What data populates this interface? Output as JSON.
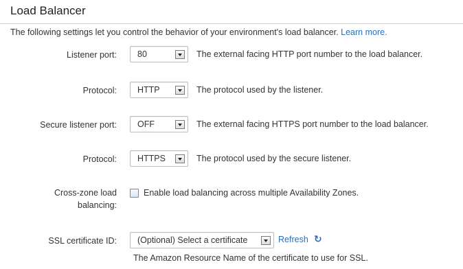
{
  "section": {
    "title": "Load Balancer",
    "intro_text": "The following settings let you control the behavior of your environment's load balancer.",
    "learn_more": "Learn more."
  },
  "fields": {
    "listener_port": {
      "label": "Listener port:",
      "value": "80",
      "help": "The external facing HTTP port number to the load balancer."
    },
    "protocol": {
      "label": "Protocol:",
      "value": "HTTP",
      "help": "The protocol used by the listener."
    },
    "secure_listener_port": {
      "label": "Secure listener port:",
      "value": "OFF",
      "help": "The external facing HTTPS port number to the load balancer."
    },
    "secure_protocol": {
      "label": "Protocol:",
      "value": "HTTPS",
      "help": "The protocol used by the secure listener."
    },
    "cross_zone": {
      "label_line1": "Cross-zone load",
      "label_line2": "balancing:",
      "checked": false,
      "checkbox_label": "Enable load balancing across multiple Availability Zones."
    },
    "ssl_certificate": {
      "label": "SSL certificate ID:",
      "value": "(Optional) Select a certificate",
      "refresh_label": "Refresh",
      "refresh_icon": "refresh-icon",
      "help": "The Amazon Resource Name of the certificate to use for SSL."
    }
  },
  "colors": {
    "link": "#2a6ebb",
    "text": "#333333",
    "rule": "#cfcfcf"
  }
}
